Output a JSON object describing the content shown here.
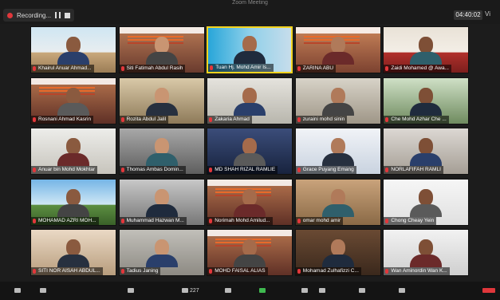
{
  "window": {
    "title": "Zoom Meeting"
  },
  "recording": {
    "label": "Recording..."
  },
  "timer": "04:40:02",
  "view_button": "Vi",
  "participants_count": "227",
  "colors": {
    "active_speaker": "#f3d31f",
    "recording": "#e0373b",
    "muted_mic": "#e2373b"
  },
  "participants": [
    {
      "name": "Khairul Anuar Ahmad..."
    },
    {
      "name": "Siti Fatimah Abdul Rasih"
    },
    {
      "name": "Tuan Hj. Mohd Amir Is..."
    },
    {
      "name": "ZARINA ABU"
    },
    {
      "name": "Zaidi Mohamed @ Awa..."
    },
    {
      "name": "Rosnani Ahmad Kasrin"
    },
    {
      "name": "Rozita Abdul Jalil"
    },
    {
      "name": "Zakaria Ahmad"
    },
    {
      "name": "zuraini mohd sinin"
    },
    {
      "name": "Che Mohd Azhar Che ..."
    },
    {
      "name": "Anuar bin Mohd Mokhtar"
    },
    {
      "name": "Thomas Ambas Domin..."
    },
    {
      "name": "MD SHAH RIZAL RAMLIE"
    },
    {
      "name": "Grace Puyang Emang"
    },
    {
      "name": "NORLAFIFAH RAMLI"
    },
    {
      "name": "MOHAMAD AZRI MOH..."
    },
    {
      "name": "Muhammad Hazwan M..."
    },
    {
      "name": "Norimah Mohd Amilud..."
    },
    {
      "name": "omar mohd amir"
    },
    {
      "name": "Chong Cheay Yein"
    },
    {
      "name": "SITI NOR AISAH ABDUL..."
    },
    {
      "name": "Tadius Janing"
    },
    {
      "name": "MOHD FAISAL ALIAS"
    },
    {
      "name": "Mohamad Zulhafizzi C..."
    },
    {
      "name": "Wan Aminordin Wan K..."
    }
  ]
}
